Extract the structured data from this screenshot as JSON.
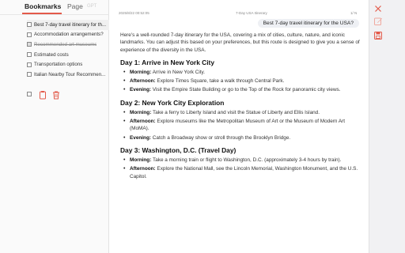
{
  "tabs": {
    "bookmarks": "Bookmarks",
    "page": "Page",
    "extra": "GPT"
  },
  "bookmarks": [
    {
      "label": "Best 7-day travel itinerary for th...",
      "checked": false,
      "active": true
    },
    {
      "label": "Accommodation arrangements?",
      "checked": false,
      "active": false
    },
    {
      "label": "Recommended art museums",
      "checked": true,
      "active": false
    },
    {
      "label": "Estimated costs",
      "checked": false,
      "active": false
    },
    {
      "label": "Transportation options",
      "checked": false,
      "active": false
    },
    {
      "label": "Italian Nearby Tour Recommen...",
      "checked": false,
      "active": false
    }
  ],
  "doc": {
    "timestamp": "2025/8/22 00:52:05",
    "title": "7-Day USA Itinerary",
    "page_counter": "1/ N"
  },
  "user_prompt": "Best 7-day travel itinerary for the USA?",
  "intro": "Here's a well-rounded 7-day itinerary for the USA, covering a mix of cities, culture, nature, and iconic landmarks. You can adjust this based on your preferences, but this route is designed to give you a sense of experience of the diversity in the USA.",
  "days": [
    {
      "title": "Day 1: Arrive in New York City",
      "items": [
        {
          "label": "Morning:",
          "text": " Arrive in New York City."
        },
        {
          "label": "Afternoon:",
          "text": " Explore Times Square, take a walk through Central Park."
        },
        {
          "label": "Evening:",
          "text": " Visit the Empire State Building or go to the Top of the Rock for panoramic city views."
        }
      ]
    },
    {
      "title": "Day 2: New York City Exploration",
      "items": [
        {
          "label": "Morning:",
          "text": " Take a ferry to Liberty Island and visit the Statue of Liberty and Ellis Island."
        },
        {
          "label": "Afternoon:",
          "text": " Explore museums like the Metropolitan Museum of Art or the Museum of Modern Art (MoMA)."
        },
        {
          "label": "Evening:",
          "text": " Catch a Broadway show or stroll through the Brooklyn Bridge."
        }
      ]
    },
    {
      "title": "Day 3: Washington, D.C. (Travel Day)",
      "items": [
        {
          "label": "Morning:",
          "text": " Take a morning train or flight to Washington, D.C. (approximately 3-4 hours by train)."
        },
        {
          "label": "Afternoon:",
          "text": " Explore the National Mall, see the Lincoln Memorial, Washington Monument, and the U.S. Capitol."
        }
      ]
    }
  ],
  "colors": {
    "accent": "#e35a4a",
    "delete": "#e35a4a"
  },
  "icons": {
    "close": "close-icon",
    "edit": "edit-icon",
    "save": "save-icon",
    "clipboard": "clipboard-icon",
    "trash": "trash-icon"
  }
}
